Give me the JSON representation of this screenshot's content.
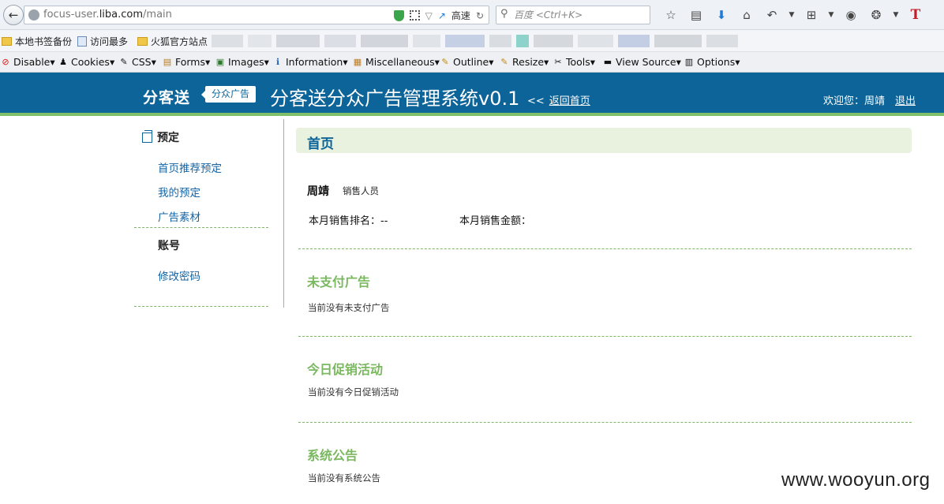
{
  "browser": {
    "url_prefix": "focus-user.",
    "url_domain": "liba.com",
    "url_path": "/main",
    "speed_label": "高速",
    "search_placeholder": "百度 <Ctrl+K>",
    "toolbar_icons": [
      "star-icon",
      "reading-list-icon",
      "download-icon",
      "home-icon",
      "undo-icon",
      "dropdown-icon",
      "crop-icon",
      "dropdown-icon",
      "chat-icon",
      "bug-icon",
      "dropdown-icon",
      "t-icon"
    ]
  },
  "bookmarks": [
    {
      "label": "本地书签备份",
      "icon": "folder-icon"
    },
    {
      "label": "访问最多",
      "icon": "page-icon"
    },
    {
      "label": "火狐官方站点",
      "icon": "folder-icon"
    }
  ],
  "devbar": [
    {
      "label": "Disable▾",
      "icon": "⊘"
    },
    {
      "label": "Cookies▾",
      "icon": "♟"
    },
    {
      "label": "CSS▾",
      "icon": "✎"
    },
    {
      "label": "Forms▾",
      "icon": "▤"
    },
    {
      "label": "Images▾",
      "icon": "▣"
    },
    {
      "label": "Information▾",
      "icon": "ℹ"
    },
    {
      "label": "Miscellaneous▾",
      "icon": "▦"
    },
    {
      "label": "Outline▾",
      "icon": "✎"
    },
    {
      "label": "Resize▾",
      "icon": "✎"
    },
    {
      "label": "Tools▾",
      "icon": "✂"
    },
    {
      "label": "View Source▾",
      "icon": "▬"
    },
    {
      "label": "Options▾",
      "icon": "▥"
    }
  ],
  "header": {
    "logo": "分客送",
    "badge": "分众广告",
    "title": "分客送分众广告管理系统v0.1",
    "back_chevron": "<<",
    "back_link": "返回首页",
    "welcome": "欢迎您：周靖",
    "logout": "退出"
  },
  "sidebar": {
    "section1": "预定",
    "items1": [
      "首页推荐预定",
      "我的预定",
      "广告素材"
    ],
    "section2": "账号",
    "items2": [
      "修改密码"
    ]
  },
  "main": {
    "page_title": "首页",
    "user_name": "周靖",
    "user_role": "销售人员",
    "rank_label": "本月销售排名：--",
    "amount_label": "本月销售金额：",
    "sections": [
      {
        "title": "未支付广告",
        "empty": "当前没有未支付广告"
      },
      {
        "title": "今日促销活动",
        "empty": "当前没有今日促销活动"
      },
      {
        "title": "系统公告",
        "empty": "当前没有系统公告"
      }
    ]
  },
  "watermark": "www.wooyun.org",
  "colors": {
    "header_bg": "#0d6499",
    "accent_green": "#7ab85f",
    "title_bar_bg": "#e8f2df",
    "link_blue": "#1565a6"
  }
}
